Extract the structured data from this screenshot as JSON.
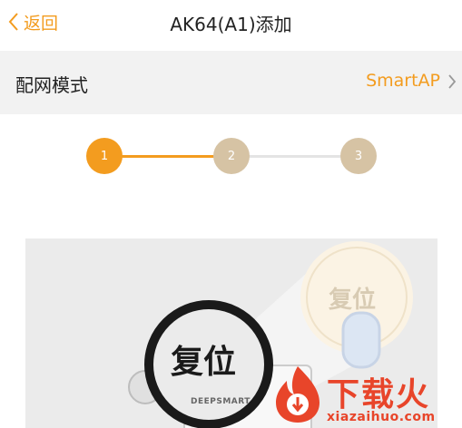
{
  "header": {
    "back_label": "返回",
    "title": "AK64(A1)添加"
  },
  "mode": {
    "label": "配网模式",
    "value": "SmartAP"
  },
  "steps": [
    {
      "label": "1",
      "state": "active"
    },
    {
      "label": "2",
      "state": "pending"
    },
    {
      "label": "3",
      "state": "pending"
    }
  ],
  "illustration": {
    "zoom_text": "复位",
    "main_text": "复位",
    "brand_text": "DEEPSMART"
  },
  "watermark": {
    "main": "下载火",
    "sub": "xiazaihuo.com"
  },
  "colors": {
    "accent": "#f39c1f",
    "step_pending": "#d6c3a4",
    "watermark": "#e8452a"
  }
}
